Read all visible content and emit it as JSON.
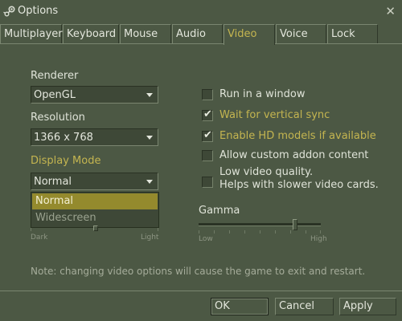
{
  "window": {
    "title": "Options",
    "close_glyph": "✕",
    "icon": "steam-logo-icon"
  },
  "tabs": [
    {
      "label": "Multiplayer",
      "active": false
    },
    {
      "label": "Keyboard",
      "active": false
    },
    {
      "label": "Mouse",
      "active": false
    },
    {
      "label": "Audio",
      "active": false
    },
    {
      "label": "Video",
      "active": true
    },
    {
      "label": "Voice",
      "active": false
    },
    {
      "label": "Lock",
      "active": false
    }
  ],
  "renderer": {
    "label": "Renderer",
    "value": "OpenGL"
  },
  "resolution": {
    "label": "Resolution",
    "value": "1366 x 768"
  },
  "display_mode": {
    "label": "Display Mode",
    "value": "Normal",
    "options": [
      "Normal",
      "Widescreen"
    ],
    "highlighted": "Normal"
  },
  "brightness": {
    "min_label": "Dark",
    "max_label": "Light"
  },
  "checkboxes": [
    {
      "label": "Run in a window",
      "checked": false
    },
    {
      "label": "Wait for vertical sync",
      "checked": true
    },
    {
      "label": "Enable HD models if available",
      "checked": true
    },
    {
      "label": "Allow custom addon content",
      "checked": false
    },
    {
      "label_line1": "Low video quality.",
      "label_line2": "Helps with slower video cards.",
      "checked": false
    }
  ],
  "gamma": {
    "label": "Gamma",
    "min_label": "Low",
    "max_label": "High",
    "level": 0.79
  },
  "note": "Note: changing video options will cause the game to exit and restart.",
  "buttons": {
    "ok": "OK",
    "cancel": "Cancel",
    "apply": "Apply"
  },
  "colors": {
    "background": "#4c5844",
    "accent": "#c4b550",
    "selection": "#948a2d"
  }
}
